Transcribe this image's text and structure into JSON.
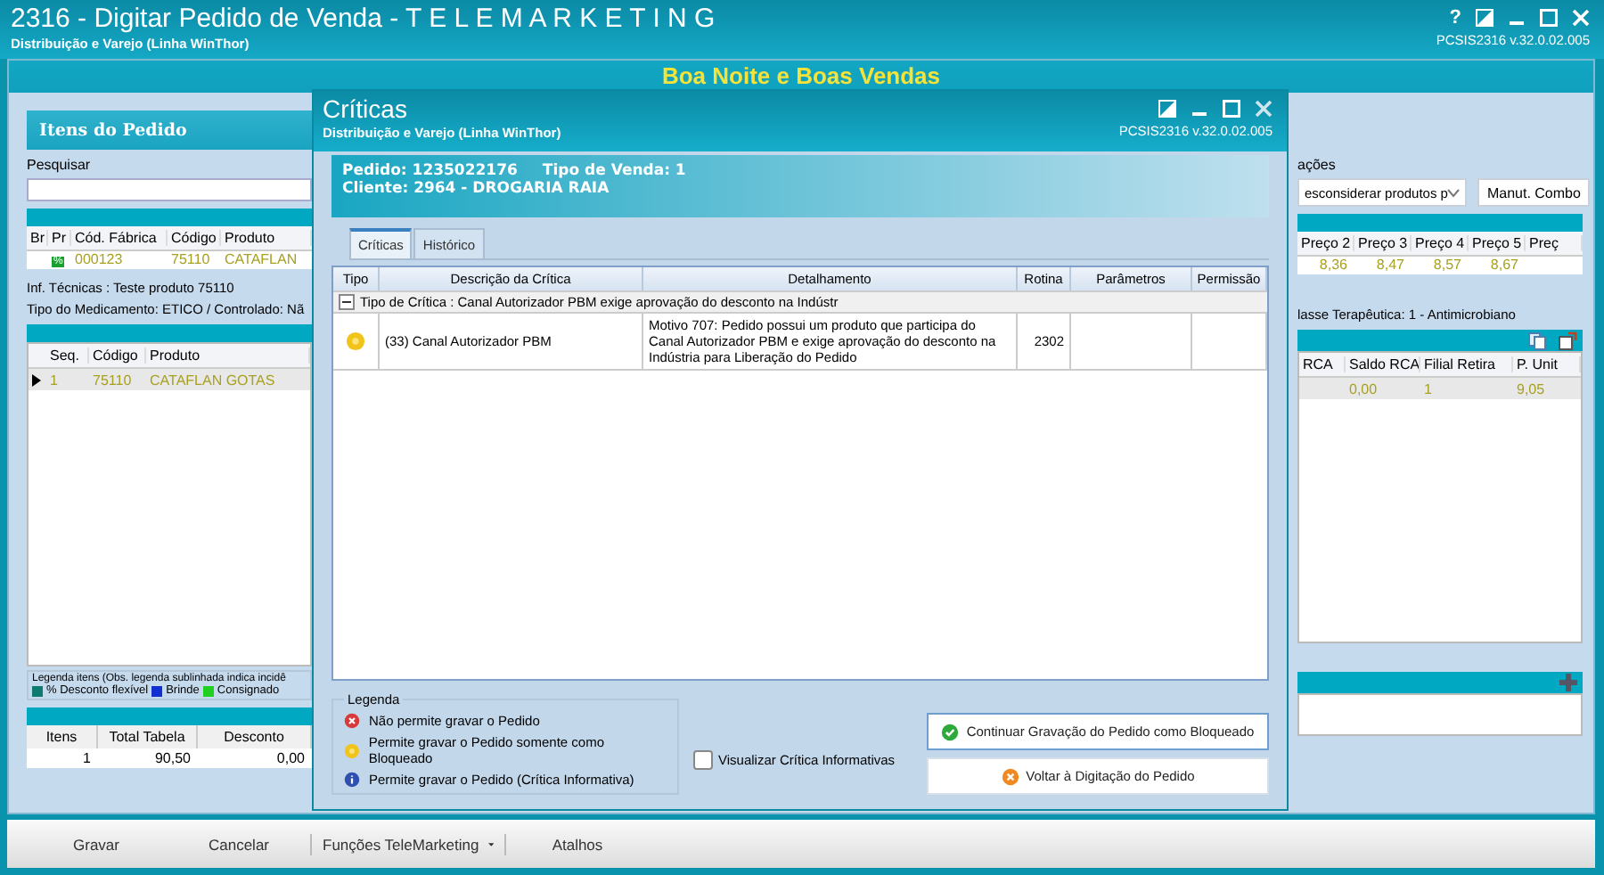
{
  "window": {
    "title": "2316 - Digitar Pedido de Venda - T E L E M A R K E T I N G",
    "subtitle": "Distribuição e Varejo (Linha WinThor)",
    "help": "?",
    "version": "PCSIS2316  v.32.0.02.005"
  },
  "banner": "Boa Noite e Boas Vendas",
  "left_panel": {
    "title": "Itens do Pedido",
    "search_label": "Pesquisar",
    "columns": [
      "Br",
      "Pr",
      "Cód. Fábrica",
      "Código",
      "Produto"
    ],
    "row": {
      "badge": "%",
      "factory_code": "000123",
      "code": "75110",
      "product": "CATAFLAN"
    },
    "tech_info": "Inf. Técnicas : Teste produto 75110",
    "med_type": "Tipo do Medicamento: ETICO / Controlado: Nã",
    "items_columns": [
      "Seq.",
      "Código",
      "Produto"
    ],
    "items_row": [
      "1",
      "75110",
      "CATAFLAN GOTAS"
    ],
    "legend_title": "Legenda itens (Obs. legenda sublinhada indica incidê",
    "legend": [
      {
        "label": "% Desconto flexível",
        "color": "#0f7a70"
      },
      {
        "label": "Brinde",
        "color": "#1030d0"
      },
      {
        "label": "Consignado",
        "color": "#20d020"
      }
    ],
    "totals_columns": [
      "Itens",
      "Total Tabela",
      "Desconto"
    ],
    "totals_row": [
      "1",
      "90,50",
      "0,00"
    ]
  },
  "right_panel": {
    "options_label": "ações",
    "dropdown": "esconsiderar produtos p",
    "combo_button": "Manut. Combo",
    "price_columns": [
      "Preço 2",
      "Preço 3",
      "Preço 4",
      "Preço 5",
      "Preç"
    ],
    "prices": [
      "8,36",
      "8,47",
      "8,57",
      "8,67"
    ],
    "class_info": "lasse Terapêutica: 1 - Antimicrobiano",
    "items_columns": [
      "RCA",
      "Saldo RCA",
      "Filial Retira",
      "P. Unit"
    ],
    "items_row": [
      "0,00",
      "1",
      "9,05"
    ]
  },
  "toolbar": [
    {
      "label": "Gravar",
      "kind": "button"
    },
    {
      "label": "Cancelar",
      "kind": "button"
    },
    {
      "label": "Funções TeleMarketing",
      "kind": "menu"
    },
    {
      "label": "Atalhos",
      "kind": "button"
    }
  ],
  "dialog": {
    "title": "Críticas",
    "subtitle": "Distribuição e Varejo (Linha WinThor)",
    "version": "PCSIS2316  v.32.0.02.005",
    "order_line": "Pedido: 1235022176",
    "sale_type": "Tipo de Venda: 1",
    "client": "Cliente: 2964 - DROGARIA RAIA",
    "tabs": [
      {
        "label": "Críticas",
        "selected": true
      },
      {
        "label": "Histórico",
        "selected": false
      }
    ],
    "columns": [
      "Tipo",
      "Descrição da Crítica",
      "Detalhamento",
      "Rotina",
      "Parâmetros",
      "Permissão"
    ],
    "groups": [
      {
        "label": "Tipo de Crítica : Canal Autorizador PBM exige aprovação do desconto na Indústr",
        "expanded": true,
        "rows": [
          {
            "kind": "warning",
            "description": "(33) Canal Autorizador PBM",
            "detail": "Motivo 707: Pedido possui um produto que participa do Canal Autorizador PBM e exige aprovação do desconto na Indústria para Liberação do Pedido",
            "routine": "2302"
          }
        ]
      }
    ],
    "legend_title": "Legenda",
    "legend": [
      {
        "kind": "error",
        "label": "Não permite gravar o Pedido"
      },
      {
        "kind": "warning",
        "label": "Permite gravar o Pedido somente como Bloqueado"
      },
      {
        "kind": "info",
        "label": "Permite gravar o Pedido (Crítica Informativa)"
      }
    ],
    "show_info": {
      "label": "Visualizar Crítica Informativas",
      "checked": false
    },
    "buttons": [
      {
        "kind": "ok",
        "label": "Continuar Gravação do Pedido como Bloqueado"
      },
      {
        "kind": "cancel",
        "label": "Voltar à Digitação do Pedido"
      }
    ]
  }
}
